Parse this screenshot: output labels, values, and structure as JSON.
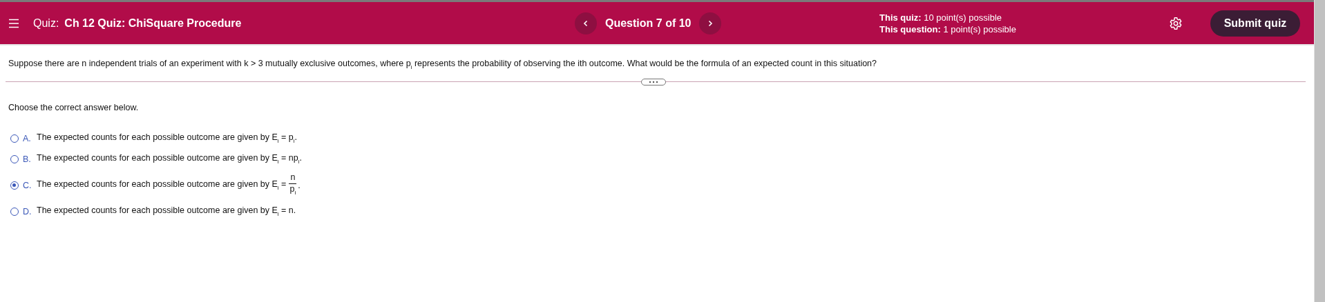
{
  "header": {
    "quiz_label": "Quiz:",
    "quiz_title": "Ch 12 Quiz: ChiSquare Procedure",
    "question_position": "Question 7 of 10",
    "points": [
      "**This quiz:** 10 point(s) possible",
      "**This question:** 1 point(s) possible"
    ],
    "submit_button": "Submit quiz"
  },
  "question": {
    "text": "Suppose there are n independent trials of an experiment with k > 3 mutually exclusive outcomes, where p$_{i}$ represents the probability of observing the ith outcome. What would be the formula of an expected count in this situation?"
  },
  "instruction": "Choose the correct answer below.",
  "options": [
    {
      "letter": "A.",
      "kind": "plain",
      "text": "The expected counts for each possible outcome are given by E$_{i}$ = p$_{i}$.",
      "selected": false
    },
    {
      "letter": "B.",
      "kind": "plain",
      "text": "The expected counts for each possible outcome are given by E$_{i}$ = np$_{i}$.",
      "selected": false
    },
    {
      "letter": "C.",
      "kind": "fraction",
      "text": "The expected counts for each possible outcome are given by E$_{i}$ =",
      "numerator": "n",
      "denominator": "p$_{i}$",
      "suffix": ".",
      "selected": true
    },
    {
      "letter": "D.",
      "kind": "plain",
      "text": "The expected counts for each possible outcome are given by E$_{i}$ = n.",
      "selected": false
    }
  ]
}
